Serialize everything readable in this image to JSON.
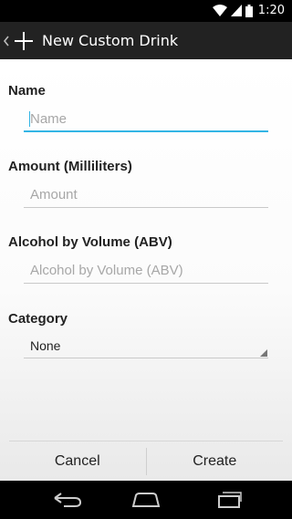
{
  "status_bar": {
    "time": "1:20"
  },
  "action_bar": {
    "title": "New Custom Drink"
  },
  "form": {
    "name": {
      "label": "Name",
      "placeholder": "Name",
      "value": ""
    },
    "amount": {
      "label": "Amount (Milliliters)",
      "placeholder": "Amount",
      "value": ""
    },
    "abv": {
      "label": "Alcohol by Volume (ABV)",
      "placeholder": "Alcohol by Volume (ABV)",
      "value": ""
    },
    "category": {
      "label": "Category",
      "selected": "None"
    }
  },
  "buttons": {
    "cancel": "Cancel",
    "create": "Create"
  },
  "colors": {
    "accent": "#33b5e5",
    "action_bar": "#222222"
  },
  "icons": [
    "wifi-icon",
    "signal-icon",
    "battery-icon",
    "up-caret-icon",
    "plus-icon",
    "back-icon",
    "home-icon",
    "recents-icon",
    "dropdown-arrow-icon"
  ]
}
